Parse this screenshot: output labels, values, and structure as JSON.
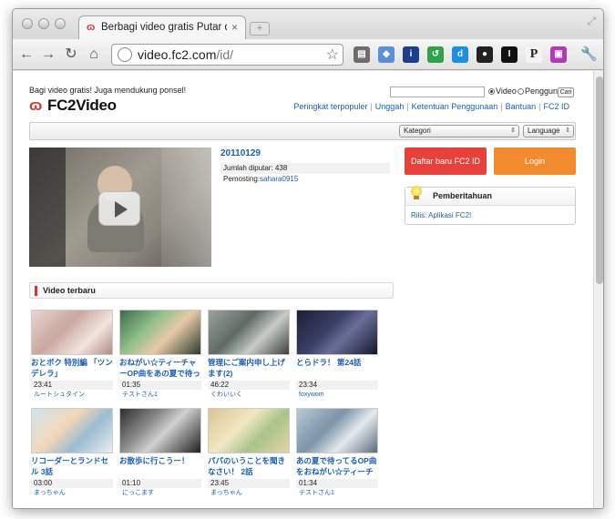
{
  "browser": {
    "tab_title": "Berbagi video gratis Putar d",
    "tab_close": "×",
    "url_host": "video.fc2.com",
    "url_path": "/id/"
  },
  "header": {
    "tagline": "Bagi video gratis! Juga mendukung ponsel!",
    "logo_text": "FC2Video",
    "search_placeholder": "",
    "radio_video": "Video",
    "radio_user": "Pengguna",
    "search_button": "Cari",
    "nav": [
      "Peringkat terpopuler",
      "Unggah",
      "Ketentuan Penggunaan",
      "Bantuan",
      "FC2 ID"
    ],
    "category_select": "Kategori",
    "language_select": "Language"
  },
  "featured": {
    "title": "20110129",
    "views_label": "Jumlah diputar: ",
    "views": "438",
    "uploader_label": "Pemosting:",
    "uploader": "sahara0915"
  },
  "account": {
    "register_button": "Daftar baru FC2 ID",
    "login_button": "Login",
    "register_color": "#e8413c",
    "login_color": "#f28a2e"
  },
  "notice": {
    "title": "Pemberitahuan",
    "link": "Rilis: Aplikasi FC2!"
  },
  "latest": {
    "title": "Video terbaru",
    "videos": [
      {
        "title": "おとボク 特別編 「ツンデレラ」",
        "duration": "23:41",
        "user": "ルートシュタイン"
      },
      {
        "title": "おねがい☆ティーチャーOP曲をあの夏で待っ",
        "duration": "01:35",
        "user": "テストさん1"
      },
      {
        "title": "管理にご案内申し上げます(2)",
        "duration": "46:22",
        "user": "くわいいく"
      },
      {
        "title": "とらドラ！ 第24話",
        "duration": "23:34",
        "user": "foxywom"
      },
      {
        "title": "リコーダーとランドセル 3話",
        "duration": "03:00",
        "user": "まっちゃん"
      },
      {
        "title": "お散歩に行こうー！",
        "duration": "01:10",
        "user": "にっこます"
      },
      {
        "title": "パパのいうことを聞きなさい！ 2話",
        "duration": "23:45",
        "user": "まっちゃん"
      },
      {
        "title": "あの夏で待ってるOP曲をおねがい☆ティーチ",
        "duration": "01:34",
        "user": "テストさん1"
      }
    ]
  }
}
